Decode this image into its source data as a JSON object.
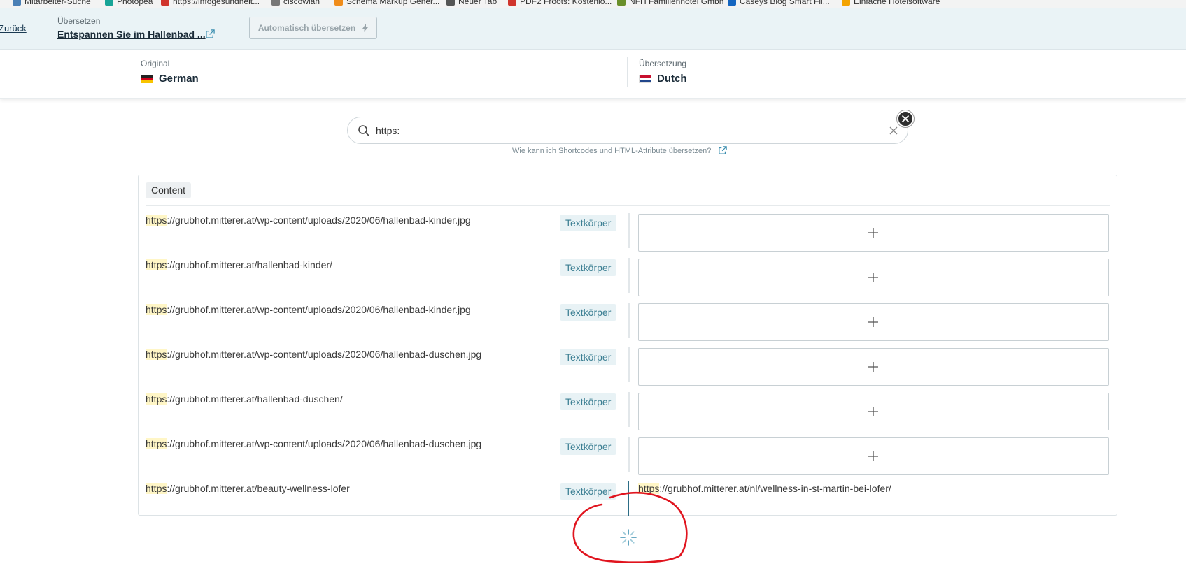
{
  "bookmarks": [
    {
      "label": "Mitarbeiter-Suche",
      "color": "#4a7fb5"
    },
    {
      "label": "Photopea",
      "color": "#18a497"
    },
    {
      "label": "https://infogesundheit...",
      "color": "#d0342c"
    },
    {
      "label": "ciscowlan",
      "color": "#777777"
    },
    {
      "label": "Schema Markup Gener...",
      "color": "#f08c1a"
    },
    {
      "label": "Neuer Tab",
      "color": "#555555"
    },
    {
      "label": "PDF2 Froots: Kostenlo...",
      "color": "#d0342c"
    },
    {
      "label": "NFH Familienhotel Gmbh",
      "color": "#6a8f2a"
    },
    {
      "label": "Caseys Blog Smart Fil...",
      "color": "#1565c0"
    },
    {
      "label": "Einfache Hotelsoftware",
      "color": "#f4a300"
    }
  ],
  "topbar": {
    "back_label": "Zurück",
    "translate_label": "Übersetzen",
    "page_title": "Entspannen Sie im Hallenbad ...",
    "auto_translate_label": "Automatisch übersetzen"
  },
  "languages": {
    "original_label": "Original",
    "original_name": "German",
    "translation_label": "Übersetzung",
    "translation_name": "Dutch"
  },
  "search": {
    "value": "https:",
    "help_text": "Wie kann ich Shortcodes und HTML-Attribute übersetzen?"
  },
  "content": {
    "section_label": "Content",
    "rows": [
      {
        "match": "https",
        "rest": "://grubhof.mitterer.at/wp-content/uploads/2020/06/hallenbad-kinder.jpg",
        "type": "Textkörper",
        "translated": false
      },
      {
        "match": "https",
        "rest": "://grubhof.mitterer.at/hallenbad-kinder/",
        "type": "Textkörper",
        "translated": false
      },
      {
        "match": "https",
        "rest": "://grubhof.mitterer.at/wp-content/uploads/2020/06/hallenbad-kinder.jpg",
        "type": "Textkörper",
        "translated": false
      },
      {
        "match": "https",
        "rest": "://grubhof.mitterer.at/wp-content/uploads/2020/06/hallenbad-duschen.jpg",
        "type": "Textkörper",
        "translated": false
      },
      {
        "match": "https",
        "rest": "://grubhof.mitterer.at/hallenbad-duschen/",
        "type": "Textkörper",
        "translated": false
      },
      {
        "match": "https",
        "rest": "://grubhof.mitterer.at/wp-content/uploads/2020/06/hallenbad-duschen.jpg",
        "type": "Textkörper",
        "translated": false
      },
      {
        "match": "https",
        "rest": "://grubhof.mitterer.at/beauty-wellness-lofer",
        "type": "Textkörper",
        "translated": true,
        "target_match": "https",
        "target_rest": "://grubhof.mitterer.at/nl/wellness-in-st-martin-bei-lofer/"
      }
    ]
  },
  "colors": {
    "accent": "#2c6d86",
    "highlight": "#fff6c6",
    "badge_text": "#3c7f93",
    "annotation": "#e0141e"
  },
  "icons": [
    "search-icon",
    "clear-icon",
    "close-icon",
    "external-link-icon",
    "lightning-icon",
    "plus-icon",
    "loading-spinner-icon"
  ]
}
